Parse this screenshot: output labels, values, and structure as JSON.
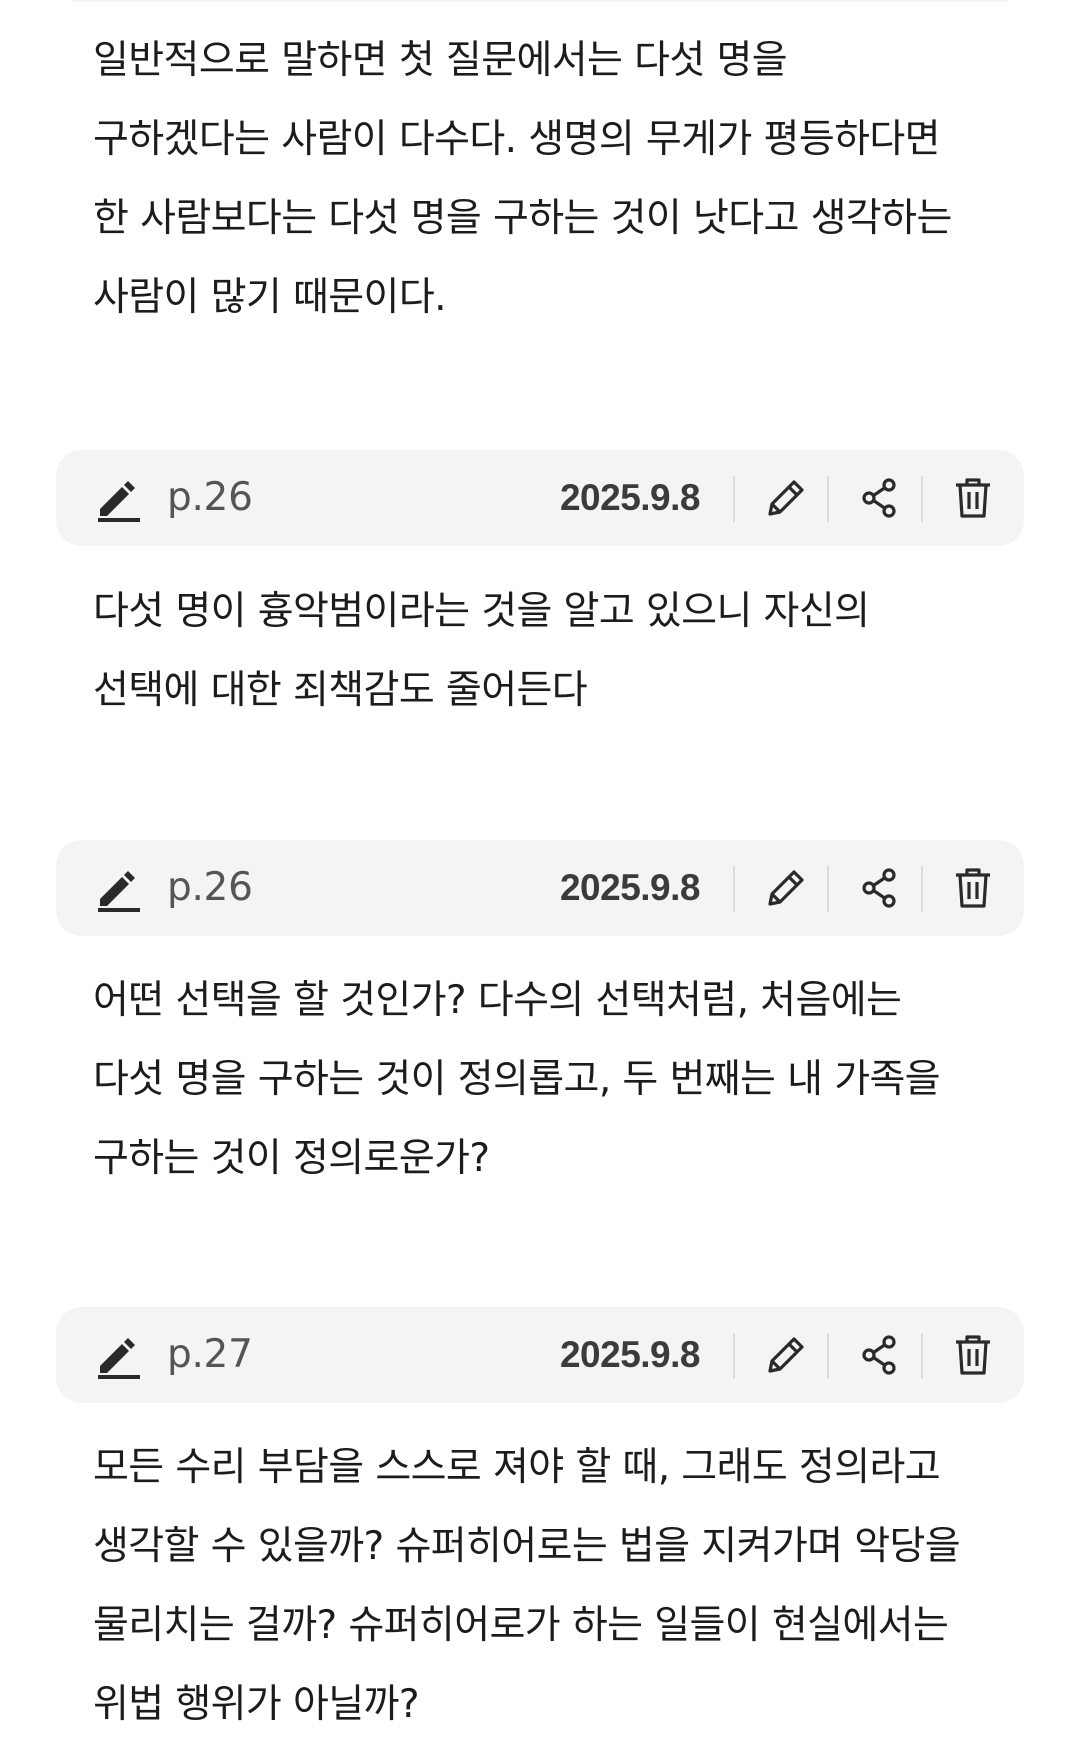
{
  "passages": [
    "일반적으로 말하면 첫 질문에서는 다섯 명을\n구하겠다는 사람이 다수다. 생명의 무게가 평등하다면\n한 사람보다는 다섯 명을 구하는 것이 낫다고 생각하는\n사람이 많기 때문이다.",
    "다섯 명이 흉악범이라는 것을 알고 있으니 자신의\n선택에 대한 죄책감도 줄어든다",
    "어떤 선택을 할 것인가? 다수의 선택처럼, 처음에는\n다섯 명을 구하는 것이 정의롭고, 두 번째는 내 가족을\n구하는 것이 정의로운가?",
    "모든 수리 부담을 스스로 져야 할 때, 그래도 정의라고\n생각할 수 있을까? 슈퍼히어로는 법을 지켜가며 악당을\n물리치는 걸까? 슈퍼히어로가 하는 일들이 현실에서는\n위법 행위가 아닐까?"
  ],
  "notes": [
    {
      "page": "p.26",
      "date": "2025.9.8"
    },
    {
      "page": "p.26",
      "date": "2025.9.8"
    },
    {
      "page": "p.27",
      "date": "2025.9.8"
    }
  ],
  "icons": {
    "highlight": "highlighter-pen-icon",
    "edit": "pencil-icon",
    "share": "share-icon",
    "delete": "trash-icon"
  },
  "colors": {
    "bar_background": "#f4f4f4",
    "text": "#1c1c1c",
    "icon": "#2a2a2a"
  }
}
